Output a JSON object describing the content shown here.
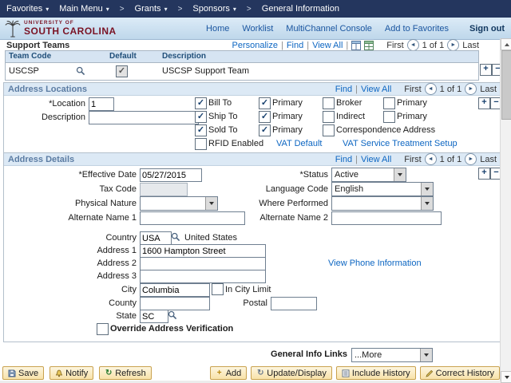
{
  "icons": {
    "caret": "▾",
    "chevron": ">",
    "prev": "◄",
    "next": "►",
    "plus": "+",
    "minus": "−",
    "refresh": "↻",
    "update": "↻",
    "add": "+"
  },
  "ui": {
    "sep": "|"
  },
  "topnav": {
    "favorites": "Favorites",
    "main_menu": "Main Menu",
    "crumb1": "Grants",
    "crumb2": "Sponsors",
    "crumb3": "General Information"
  },
  "header": {
    "logo_top": "UNIVERSITY OF",
    "logo_bottom": "SOUTH CAROLINA",
    "home": "Home",
    "worklist": "Worklist",
    "multichannel": "MultiChannel Console",
    "add_to_favorites": "Add to Favorites",
    "sign_out": "Sign out"
  },
  "support_teams": {
    "title": "Support Teams",
    "personalize": "Personalize",
    "find": "Find",
    "view_all": "View All",
    "first": "First",
    "page": "1 of 1",
    "last": "Last",
    "col_team_code": "Team Code",
    "col_default": "Default",
    "col_description": "Description",
    "row": {
      "team_code": "USCSP",
      "default_checked": true,
      "description": "USCSP Support Team"
    }
  },
  "address_locations": {
    "title": "Address Locations",
    "find": "Find",
    "view_all": "View All",
    "first": "First",
    "page": "1 of 1",
    "last": "Last",
    "location_label": "*Location",
    "location_value": "1",
    "description_label": "Description",
    "description_value": "",
    "cb": {
      "bill_to": {
        "label": "Bill To",
        "checked": true
      },
      "bill_primary": {
        "label": "Primary",
        "checked": true
      },
      "broker": {
        "label": "Broker",
        "checked": false
      },
      "broker_primary": {
        "label": "Primary",
        "checked": false
      },
      "ship_to": {
        "label": "Ship To",
        "checked": true
      },
      "ship_primary": {
        "label": "Primary",
        "checked": true
      },
      "indirect": {
        "label": "Indirect",
        "checked": false
      },
      "indirect_primary": {
        "label": "Primary",
        "checked": false
      },
      "sold_to": {
        "label": "Sold To",
        "checked": true
      },
      "sold_primary": {
        "label": "Primary",
        "checked": true
      },
      "correspondence": {
        "label": "Correspondence Address",
        "checked": false
      }
    },
    "rfid": {
      "label": "RFID Enabled",
      "checked": false
    },
    "vat_default": "VAT Default",
    "vat_service": "VAT Service Treatment Setup"
  },
  "address_details": {
    "title": "Address Details",
    "find": "Find",
    "view_all": "View All",
    "first": "First",
    "page": "1 of 1",
    "last": "Last",
    "effective_date": {
      "label": "*Effective Date",
      "value": "05/27/2015"
    },
    "status": {
      "label": "*Status",
      "value": "Active"
    },
    "tax_code": {
      "label": "Tax Code",
      "value": ""
    },
    "language_code": {
      "label": "Language Code",
      "value": "English"
    },
    "physical_nature": {
      "label": "Physical Nature",
      "value": ""
    },
    "where_performed": {
      "label": "Where Performed",
      "value": ""
    },
    "alt_name1": {
      "label": "Alternate Name 1",
      "value": ""
    },
    "alt_name2": {
      "label": "Alternate Name 2",
      "value": ""
    },
    "country": {
      "label": "Country",
      "value": "USA",
      "display": "United States"
    },
    "address1": {
      "label": "Address 1",
      "value": "1600 Hampton Street"
    },
    "address2": {
      "label": "Address 2",
      "value": ""
    },
    "address3": {
      "label": "Address 3",
      "value": ""
    },
    "city": {
      "label": "City",
      "value": "Columbia"
    },
    "in_city_limit": {
      "label": "In City Limit",
      "checked": false
    },
    "county": {
      "label": "County",
      "value": ""
    },
    "postal": {
      "label": "Postal",
      "value": ""
    },
    "state": {
      "label": "State",
      "value": "SC"
    },
    "override": {
      "label": "Override Address Verification",
      "checked": false
    },
    "view_phone": "View Phone Information"
  },
  "general_info": {
    "label": "General Info Links",
    "value": "...More"
  },
  "footer": {
    "save": "Save",
    "notify": "Notify",
    "refresh": "Refresh",
    "add": "Add",
    "update_display": "Update/Display",
    "include_history": "Include History",
    "correct_history": "Correct History"
  }
}
